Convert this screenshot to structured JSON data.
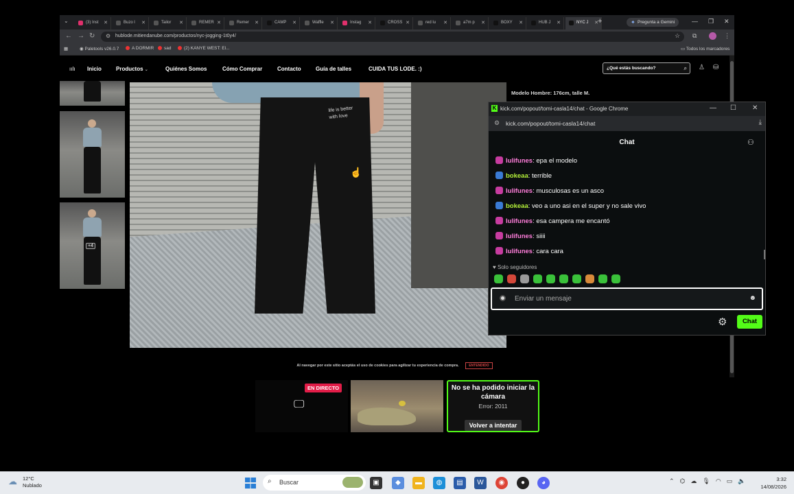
{
  "browser": {
    "tabs": [
      {
        "label": "(3) Inst",
        "color": "#e1306c"
      },
      {
        "label": "Buzo l",
        "color": "#555"
      },
      {
        "label": "Tailor",
        "color": "#555"
      },
      {
        "label": "REMER",
        "color": "#555"
      },
      {
        "label": "Remer",
        "color": "#555"
      },
      {
        "label": "CAMP",
        "color": "#111"
      },
      {
        "label": "Waffle",
        "color": "#555"
      },
      {
        "label": "Instag",
        "color": "#e1306c"
      },
      {
        "label": "CROSS",
        "color": "#111"
      },
      {
        "label": "red lu",
        "color": "#555"
      },
      {
        "label": "a7m p",
        "color": "#555"
      },
      {
        "label": "BOXY",
        "color": "#111"
      },
      {
        "label": "HUB J",
        "color": "#111"
      },
      {
        "label": "NYC J",
        "color": "#111"
      }
    ],
    "gemini_label": "Pregunta a Gemini",
    "url": "hublode.mitiendanube.com/productos/nyc-jogging-1t0y4/",
    "bookmarks": [
      "Paletools v26.0.7",
      "A DORMIR",
      "sad",
      "(2) KANYE WEST: El...",
      "Todos los marcadores"
    ]
  },
  "store": {
    "logo": "ıılı",
    "nav": [
      "Inicio",
      "Productos",
      "Quiénes Somos",
      "Cómo Comprar",
      "Contacto",
      "Guía de talles",
      "CUIDA TUS LODE. :)"
    ],
    "search_placeholder": "¿Qué estás buscando?",
    "pocket_text": "life is better with love",
    "model_info": "Modelo Hombre: 176cm, talle M.",
    "thumb_badge": "+4",
    "cookie_text": "Al navegar por este sitio aceptás el uso de cookies para agilizar tu experiencia de compra.",
    "cookie_button": "ENTENDIDO"
  },
  "kick": {
    "window_title": "kick.com/popout/tomi-casla14/chat - Google Chrome",
    "url": "kick.com/popout/tomi-casla14/chat",
    "chat_title": "Chat",
    "messages": [
      {
        "user": "lulifunes",
        "text": "epa el modelo",
        "user_color": "#ff7edb",
        "badge_color": "#c73ca0"
      },
      {
        "user": "bokeaa",
        "text": "terrible",
        "user_color": "#b5f23a",
        "badge_color": "#3a7bd5"
      },
      {
        "user": "lulifunes",
        "text": "musculosas es un asco",
        "user_color": "#ff7edb",
        "badge_color": "#c73ca0"
      },
      {
        "user": "bokeaa",
        "text": "veo a uno asi en el super y no sale vivo",
        "user_color": "#b5f23a",
        "badge_color": "#3a7bd5"
      },
      {
        "user": "lulifunes",
        "text": "esa campera me encantó",
        "user_color": "#ff7edb",
        "badge_color": "#c73ca0"
      },
      {
        "user": "lulifunes",
        "text": "siiii",
        "user_color": "#ff7edb",
        "badge_color": "#c73ca0"
      },
      {
        "user": "lulifunes",
        "text": "cara cara",
        "user_color": "#ff7edb",
        "badge_color": "#c73ca0"
      }
    ],
    "followers_only": "Solo seguidores",
    "input_placeholder": "Enviar un mensaje",
    "send_label": "Chat",
    "accent": "#53fc18"
  },
  "overlays": {
    "live_badge": "EN DIRECTO",
    "error_title": "No se ha podido iniciar la cámara",
    "error_code": "Error: 2011",
    "retry_label": "Volver a intentar"
  },
  "taskbar": {
    "temperature": "12°C",
    "weather": "Nublado",
    "search_label": "Buscar",
    "time": "3:32",
    "date": "14/08/2026"
  }
}
